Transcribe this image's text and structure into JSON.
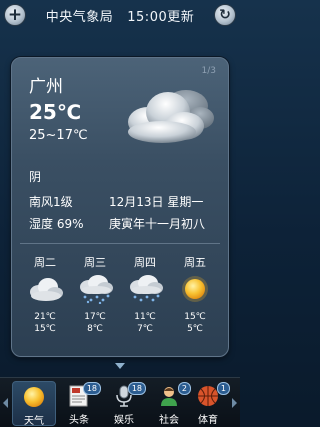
{
  "header": {
    "add_icon": "plus-icon",
    "source": "中央气象局",
    "update_time": "15:00更新",
    "refresh_icon": "refresh-icon"
  },
  "card": {
    "pager": "1/3",
    "city": "广州",
    "current_temp": "25℃",
    "temp_range": "25~17℃",
    "condition": "阴",
    "wind": "南风1级",
    "date": "12月13日 星期一",
    "humidity": "湿度 69%",
    "lunar": "庚寅年十一月初八",
    "icon": "cloud-icon"
  },
  "forecast": [
    {
      "day": "周二",
      "icon": "cloud-icon",
      "high": "21℃",
      "low": "15℃"
    },
    {
      "day": "周三",
      "icon": "rain-icon",
      "high": "17℃",
      "low": "8℃"
    },
    {
      "day": "周四",
      "icon": "rain-icon",
      "high": "11℃",
      "low": "7℃"
    },
    {
      "day": "周五",
      "icon": "sun-icon",
      "high": "15℃",
      "low": "5℃"
    }
  ],
  "nav": [
    {
      "label": "天气",
      "icon": "sun-icon",
      "badge": "",
      "active": true
    },
    {
      "label": "头条",
      "icon": "news-icon",
      "badge": "18",
      "active": false
    },
    {
      "label": "娱乐",
      "icon": "microphone-icon",
      "badge": "18",
      "active": false
    },
    {
      "label": "社会",
      "icon": "people-icon",
      "badge": "2",
      "active": false
    },
    {
      "label": "体育",
      "icon": "ball-icon",
      "badge": "1",
      "active": false
    }
  ],
  "colors": {
    "accent": "#2c5d91",
    "sun": "#f5b321",
    "background": "#0d2238"
  }
}
